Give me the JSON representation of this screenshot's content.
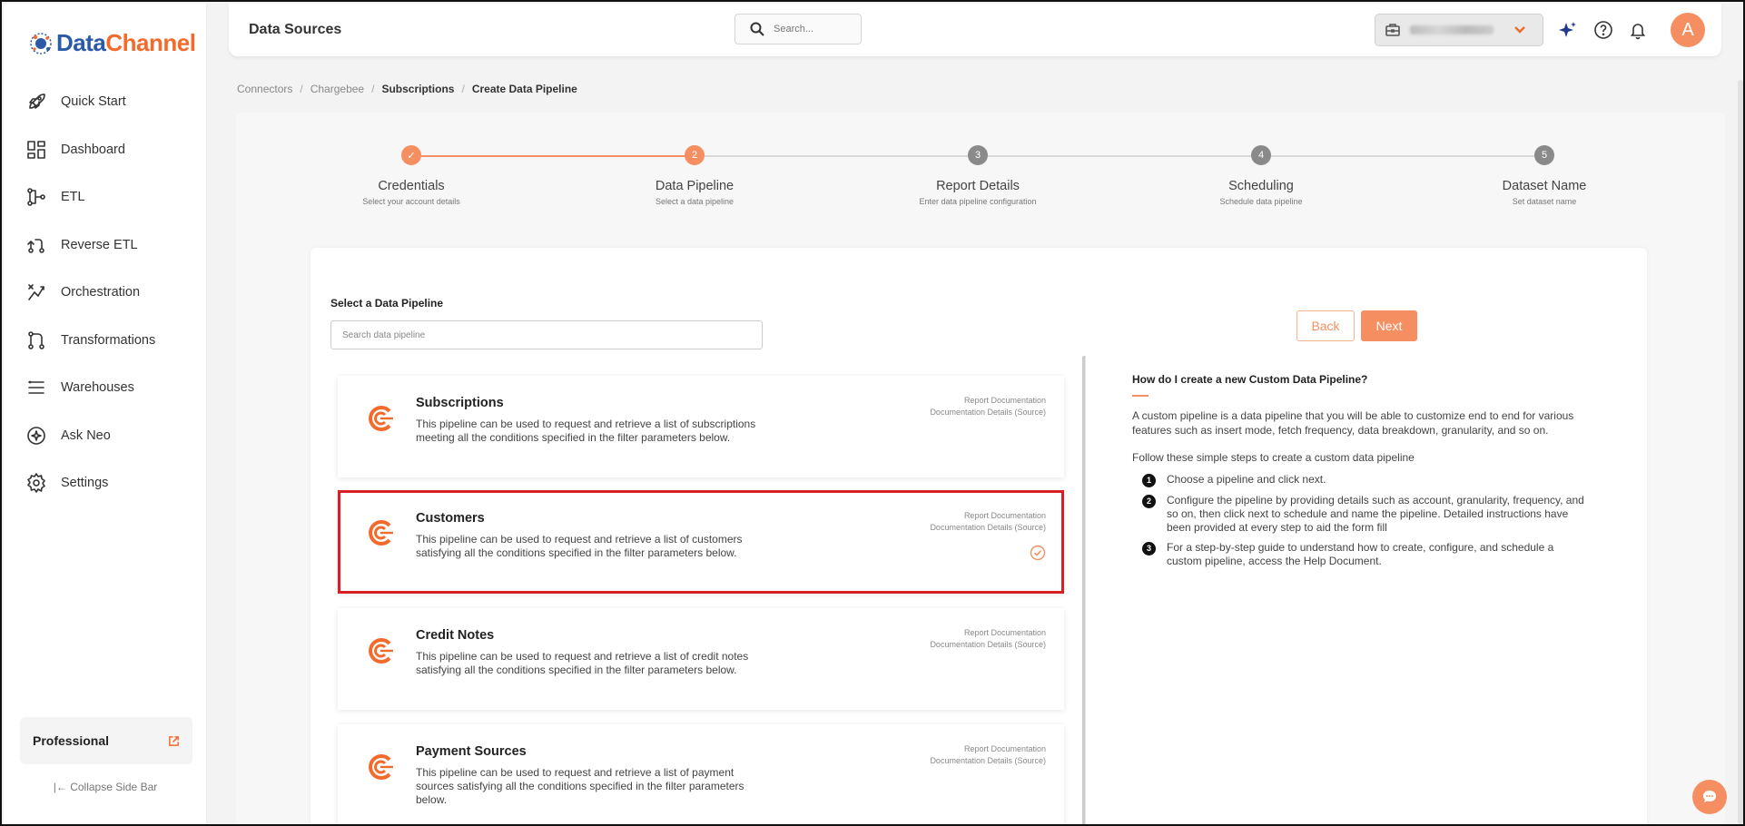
{
  "brand": {
    "part1": "Data",
    "part2": "Channel",
    "accent": "#f26b2d",
    "primary": "#2b5aa8"
  },
  "sidebar": {
    "items": [
      {
        "label": "Quick Start",
        "icon": "rocket-icon"
      },
      {
        "label": "Dashboard",
        "icon": "dashboard-icon"
      },
      {
        "label": "ETL",
        "icon": "etl-icon"
      },
      {
        "label": "Reverse ETL",
        "icon": "reverse-etl-icon"
      },
      {
        "label": "Orchestration",
        "icon": "orchestration-icon"
      },
      {
        "label": "Transformations",
        "icon": "transformations-icon"
      },
      {
        "label": "Warehouses",
        "icon": "warehouses-icon"
      },
      {
        "label": "Ask Neo",
        "icon": "ask-neo-icon"
      },
      {
        "label": "Settings",
        "icon": "settings-icon"
      }
    ],
    "plan_label": "Professional",
    "collapse_label": "Collapse Side Bar"
  },
  "header": {
    "title": "Data Sources",
    "search_placeholder": "Search...",
    "avatar_letter": "A"
  },
  "breadcrumb": [
    "Connectors",
    "Chargebee",
    "Subscriptions",
    "Create Data Pipeline"
  ],
  "steps": [
    {
      "num": "✓",
      "title": "Credentials",
      "subtitle": "Select your account details",
      "state": "done"
    },
    {
      "num": "2",
      "title": "Data Pipeline",
      "subtitle": "Select a data pipeline",
      "state": "active"
    },
    {
      "num": "3",
      "title": "Report Details",
      "subtitle": "Enter data pipeline configuration",
      "state": "pending"
    },
    {
      "num": "4",
      "title": "Scheduling",
      "subtitle": "Schedule data pipeline",
      "state": "pending"
    },
    {
      "num": "5",
      "title": "Dataset Name",
      "subtitle": "Set dataset name",
      "state": "pending"
    }
  ],
  "form": {
    "select_label": "Select a Data Pipeline",
    "search_placeholder": "Search data pipeline",
    "back_label": "Back",
    "next_label": "Next"
  },
  "pipelines": [
    {
      "name": "Subscriptions",
      "desc": "This pipeline can be used to request and retrieve a list of subscriptions meeting all the conditions specified in the filter parameters below.",
      "link1": "Report Documentation",
      "link2": "Documentation Details (Source)",
      "selected": false
    },
    {
      "name": "Customers",
      "desc": "This pipeline can be used to request and retrieve a list of customers satisfying all the conditions specified in the filter parameters below.",
      "link1": "Report Documentation",
      "link2": "Documentation Details (Source)",
      "selected": true
    },
    {
      "name": "Credit Notes",
      "desc": "This pipeline can be used to request and retrieve a list of credit notes satisfying all the conditions specified in the filter parameters below.",
      "link1": "Report Documentation",
      "link2": "Documentation Details (Source)",
      "selected": false
    },
    {
      "name": "Payment Sources",
      "desc": "This pipeline can be used to request and retrieve a list of payment sources satisfying all the conditions specified in the filter parameters below.",
      "link1": "Report Documentation",
      "link2": "Documentation Details (Source)",
      "selected": false
    }
  ],
  "help": {
    "title": "How do I create a new Custom Data Pipeline?",
    "intro": "A custom pipeline is a data pipeline that you will be able to customize end to end for various features such as insert mode, fetch frequency, data breakdown, granularity, and so on.",
    "intro2": "Follow these simple steps to create a custom data pipeline",
    "steps": [
      {
        "num": "1",
        "text": "Choose a pipeline and click next."
      },
      {
        "num": "2",
        "text": "Configure the pipeline by providing details such as account, granularity, frequency, and so on, then click next to schedule and name the pipeline. Detailed instructions have been provided at every step to aid the form fill"
      },
      {
        "num": "3",
        "text": "For a step-by-step guide to understand how to create, configure, and schedule a custom pipeline, access the Help Document."
      }
    ]
  },
  "colors": {
    "orange": "#f58f61",
    "selected_border": "#d81f26",
    "pending_step": "#8a8a8a"
  }
}
